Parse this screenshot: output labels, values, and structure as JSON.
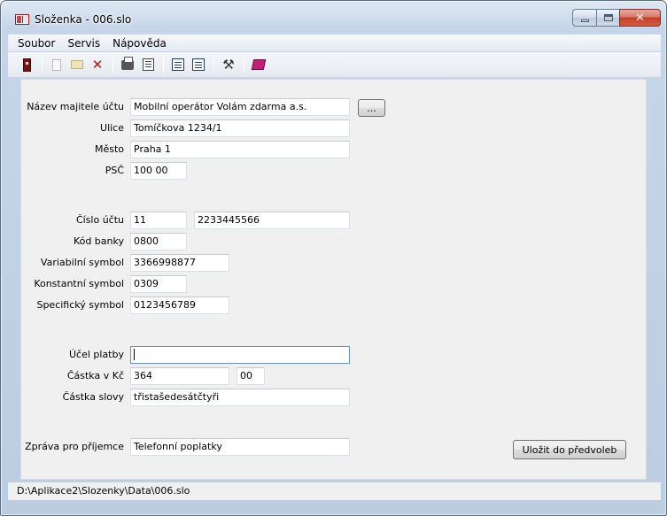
{
  "window": {
    "title": "Složenka - 006.slo",
    "controls": {
      "minimize": "minimize",
      "maximize": "maximize",
      "close": "✕"
    }
  },
  "menu": [
    "Soubor",
    "Servis",
    "Nápověda"
  ],
  "toolbar": {
    "icons": [
      "exit-icon",
      "new-icon",
      "open-icon",
      "delete-icon",
      "print-icon",
      "print-preview-icon",
      "edit-icon",
      "edit-list-icon",
      "tools-icon",
      "book-icon"
    ],
    "delete_glyph": "✕",
    "tools_glyph": "⚒"
  },
  "form": {
    "owner_label": "Název majitele účtu",
    "owner_value": "Mobilní operátor Volám zdarma a.s.",
    "browse_button": "...",
    "street_label": "Ulice",
    "street_value": "Tomíčkova 1234/1",
    "city_label": "Město",
    "city_value": "Praha 1",
    "zip_label": "PSČ",
    "zip_value": "100 00",
    "account_label": "Číslo účtu",
    "account_prefix": "11",
    "account_number": "2233445566",
    "bank_label": "Kód banky",
    "bank_value": "0800",
    "vs_label": "Variabilní symbol",
    "vs_value": "3366998877",
    "ks_label": "Konstantní symbol",
    "ks_value": "0309",
    "ss_label": "Specifický symbol",
    "ss_value": "0123456789",
    "purpose_label": "Účel platby",
    "purpose_value": "",
    "amount_label": "Částka v Kč",
    "amount_value": "364",
    "amount_cents": "00",
    "words_label": "Částka slovy",
    "words_value": "třistašedesátčtyři",
    "message_label": "Zpráva pro příjemce",
    "message_value": "Telefonní poplatky",
    "save_button": "Uložit do předvoleb"
  },
  "status": {
    "path": "D:\\Aplikace2\\Slozenky\\Data\\006.slo"
  }
}
